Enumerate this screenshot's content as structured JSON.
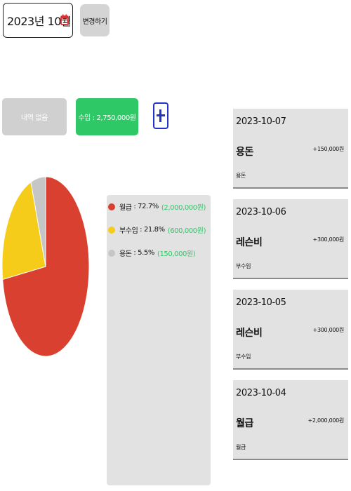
{
  "header": {
    "month_value": "2023년 10월",
    "change_label": "변경하기"
  },
  "summary": {
    "expense_label": "내역 없음",
    "income_label": "수입 : 2,750,000원"
  },
  "colors": {
    "income": "#2ec866",
    "expense_chip": "#d0d0d0",
    "add_button": "#2233cc",
    "calendar_icon": "#e0302e"
  },
  "chart_data": {
    "type": "pie",
    "title": "",
    "slices": [
      {
        "label": "월급",
        "percent": 72.7,
        "value": 2000000,
        "color": "#d9402f"
      },
      {
        "label": "부수입",
        "percent": 21.8,
        "value": 600000,
        "color": "#f5cc1a"
      },
      {
        "label": "용돈",
        "percent": 5.5,
        "value": 150000,
        "color": "#c6c6c6"
      }
    ]
  },
  "legend": {
    "items": [
      {
        "label": "월급",
        "percent": "72.7%",
        "amount": "(2,000,000원)",
        "color": "#d9402f"
      },
      {
        "label": "부수입",
        "percent": "21.8%",
        "amount": "(600,000원)",
        "color": "#f5cc1a"
      },
      {
        "label": "용돈",
        "percent": "5.5%",
        "amount": "(150,000원)",
        "color": "#c6c6c6"
      }
    ]
  },
  "entries": [
    {
      "date": "2023-10-07",
      "title": "용돈",
      "amount": "+150,000원",
      "category": "용돈"
    },
    {
      "date": "2023-10-06",
      "title": "레슨비",
      "amount": "+300,000원",
      "category": "부수입"
    },
    {
      "date": "2023-10-05",
      "title": "레슨비",
      "amount": "+300,000원",
      "category": "부수입"
    },
    {
      "date": "2023-10-04",
      "title": "월급",
      "amount": "+2,000,000원",
      "category": "월급"
    }
  ]
}
